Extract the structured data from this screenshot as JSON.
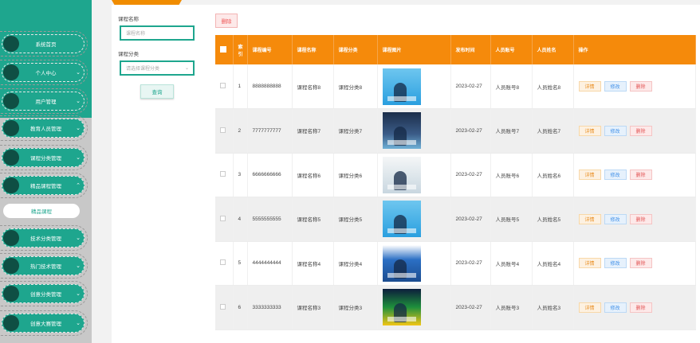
{
  "sidebar": {
    "items": [
      {
        "label": "系统首页",
        "chevron": false
      },
      {
        "label": "个人中心",
        "chevron": true
      },
      {
        "label": "用户管理",
        "chevron": true
      },
      {
        "label": "教育人员管理",
        "chevron": true
      },
      {
        "label": "课程分类管理",
        "chevron": true
      },
      {
        "label": "精品课程管理",
        "chevron": true,
        "expanded": true
      },
      {
        "label": "技术分类管理",
        "chevron": true
      },
      {
        "label": "热门技术管理",
        "chevron": true
      },
      {
        "label": "创意分类管理",
        "chevron": true
      },
      {
        "label": "创意大赛管理",
        "chevron": true
      }
    ],
    "sub_item": "精品课程"
  },
  "filter": {
    "name_label": "课程名称",
    "name_placeholder": "课程名称",
    "type_label": "课程分类",
    "type_placeholder": "请选择课程分类",
    "query_button": "查询"
  },
  "toolbar": {
    "delete_label": "删除"
  },
  "table": {
    "headers": [
      "索引",
      "课程编号",
      "课程名称",
      "课程分类",
      "课程图片",
      "发布时间",
      "人员账号",
      "人员姓名",
      "操作"
    ],
    "rows": [
      {
        "index": "1",
        "code": "8888888888",
        "name": "课程名称8",
        "type": "课程分类8",
        "date": "2023-02-27",
        "account": "人员账号8",
        "person": "人员姓名8",
        "image": "t-blue"
      },
      {
        "index": "2",
        "code": "7777777777",
        "name": "课程名称7",
        "type": "课程分类7",
        "date": "2023-02-27",
        "account": "人员账号7",
        "person": "人员姓名7",
        "image": "t-dark"
      },
      {
        "index": "3",
        "code": "6666666666",
        "name": "课程名称6",
        "type": "课程分类6",
        "date": "2023-02-27",
        "account": "人员账号6",
        "person": "人员姓名6",
        "image": "t-light"
      },
      {
        "index": "4",
        "code": "5555555555",
        "name": "课程名称5",
        "type": "课程分类5",
        "date": "2023-02-27",
        "account": "人员账号5",
        "person": "人员姓名5",
        "image": "t-blue"
      },
      {
        "index": "5",
        "code": "4444444444",
        "name": "课程名称4",
        "type": "课程分类4",
        "date": "2023-02-27",
        "account": "人员账号4",
        "person": "人员姓名4",
        "image": "t-book"
      },
      {
        "index": "6",
        "code": "3333333333",
        "name": "课程名称3",
        "type": "课程分类3",
        "date": "2023-02-27",
        "account": "人员账号3",
        "person": "人员姓名3",
        "image": "t-green"
      }
    ],
    "actions": {
      "detail": "详情",
      "edit": "修改",
      "delete": "删除"
    }
  },
  "colors": {
    "accent": "#1ea68e",
    "header": "#f58a0b"
  }
}
